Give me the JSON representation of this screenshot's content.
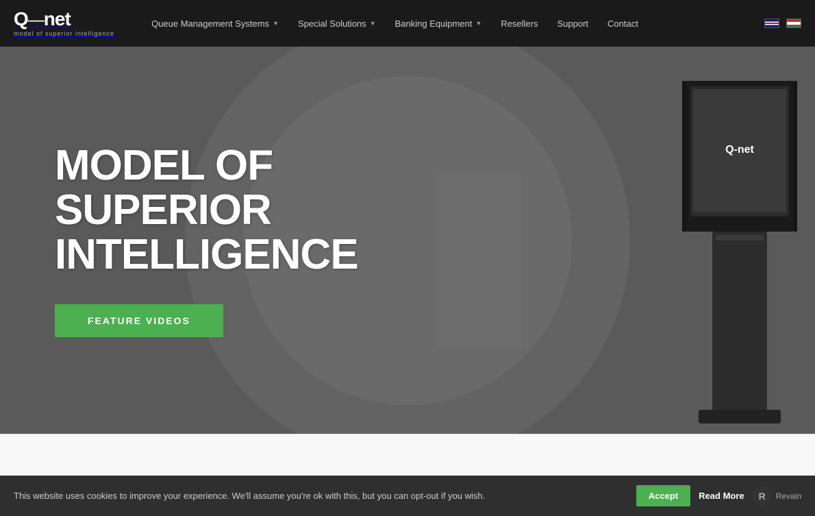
{
  "nav": {
    "logo_main": "Q-net",
    "logo_sub": "model of superior intelligence",
    "menu": [
      {
        "label": "Queue Management Systems",
        "has_dropdown": true
      },
      {
        "label": "Special Solutions",
        "has_dropdown": true
      },
      {
        "label": "Banking Equipment",
        "has_dropdown": true
      },
      {
        "label": "Resellers",
        "has_dropdown": false
      },
      {
        "label": "Support",
        "has_dropdown": false
      },
      {
        "label": "Contact",
        "has_dropdown": false
      }
    ],
    "flags": [
      "uk",
      "hu"
    ]
  },
  "hero": {
    "title": "MODEL OF SUPERIOR INTELLIGENCE",
    "cta_label": "FEATURE VIDEOS"
  },
  "cookie": {
    "message": "This website uses cookies to improve your experience. We'll assume you're ok with this, but you can opt-out if you wish.",
    "accept_label": "Accept",
    "read_more_label": "Read More",
    "revain_label": "Revain"
  },
  "colors": {
    "green": "#4caf50",
    "nav_bg": "#1a1a1a",
    "hero_bg": "#5a5a5a"
  }
}
